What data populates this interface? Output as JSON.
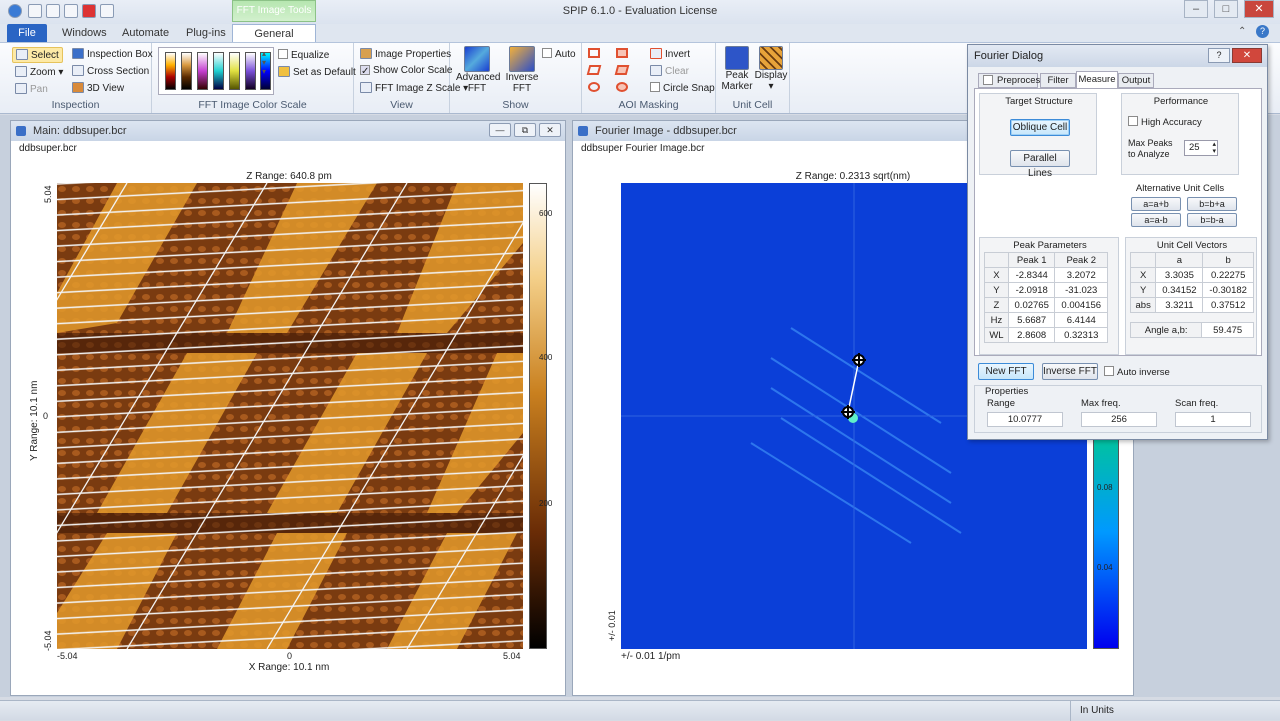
{
  "window": {
    "title": "SPIP 6.1.0 - Evaluation License",
    "context_tab": "FFT Image Tools"
  },
  "tabs": [
    "File",
    "Windows",
    "Automate",
    "Plug-ins",
    "General"
  ],
  "ribbon": {
    "inspection": {
      "select": "Select",
      "zoom": "Zoom",
      "pan": "Pan",
      "inspection_box": "Inspection Box",
      "cross_section": "Cross Section",
      "view_3d": "3D View",
      "label": "Inspection"
    },
    "color_scale": {
      "label": "FFT Image Color Scale",
      "equalize": "Equalize",
      "set_default": "Set as Default"
    },
    "view": {
      "image_properties": "Image Properties",
      "show_color_scale": "Show Color Scale",
      "fft_z_scale": "FFT Image Z Scale",
      "label": "View"
    },
    "show": {
      "advanced_fft": "Advanced\nFFT",
      "inverse_fft": "Inverse\nFFT",
      "auto": "Auto",
      "label": "Show"
    },
    "aoi": {
      "invert": "Invert",
      "clear": "Clear",
      "circle_snap": "Circle Snap",
      "label": "AOI Masking"
    },
    "unit_cell": {
      "peak_marker": "Peak\nMarker",
      "display": "Display",
      "label": "Unit Cell"
    }
  },
  "main_window": {
    "title": "Main: ddbsuper.bcr",
    "filename": "ddbsuper.bcr",
    "z_range": "Z Range:  640.8 pm",
    "y_ticks": [
      "5.04",
      "0",
      "-5.04"
    ],
    "x_ticks": [
      "-5.04",
      "0",
      "5.04"
    ],
    "y_label": "Y Range: 10.1 nm",
    "x_label": "X Range:  10.1 nm",
    "scale_ticks": [
      "600",
      "400",
      "200"
    ]
  },
  "fourier_window": {
    "title": "Fourier Image - ddbsuper.bcr",
    "filename": "ddbsuper Fourier Image.bcr",
    "z_range": "Z Range: 0.2313 sqrt(nm)",
    "y_label": "+/- 0.01",
    "x_label": "+/- 0.01 1/pm",
    "scale_ticks": [
      "0.08",
      "0.04"
    ]
  },
  "dialog": {
    "title": "Fourier Dialog",
    "tabs": [
      "Preprocess",
      "Filter",
      "Measure",
      "Output"
    ],
    "target_structure": "Target Structure",
    "oblique_cell": "Oblique Cell",
    "parallel_lines": "Parallel Lines",
    "performance": "Performance",
    "high_accuracy": "High Accuracy",
    "max_peaks": "Max Peaks\nto Analyze",
    "max_peaks_value": "25",
    "alt_unit_cells": "Alternative Unit Cells",
    "alt_buttons": [
      "a=a+b",
      "b=b+a",
      "a=a-b",
      "b=b-a"
    ],
    "peak_params": {
      "title": "Peak Parameters",
      "headers": [
        "Peak 1",
        "Peak 2"
      ],
      "rows": [
        [
          "X",
          "-2.8344",
          "3.2072"
        ],
        [
          "Y",
          "-2.0918",
          "-31.023"
        ],
        [
          "Z",
          "0.02765",
          "0.004156"
        ],
        [
          "Hz",
          "5.6687",
          "6.4144"
        ],
        [
          "WL",
          "2.8608",
          "0.32313"
        ]
      ]
    },
    "unit_vectors": {
      "title": "Unit Cell Vectors",
      "headers": [
        "a",
        "b"
      ],
      "rows": [
        [
          "X",
          "3.3035",
          "0.22275"
        ],
        [
          "Y",
          "0.34152",
          "-0.30182"
        ],
        [
          "abs",
          "3.3211",
          "0.37512"
        ]
      ],
      "angle_label": "Angle a,b:",
      "angle": "59.475"
    },
    "new_fft": "New FFT",
    "inverse_fft": "Inverse FFT",
    "auto_inverse": "Auto inverse",
    "properties": "Properties",
    "prop_headers": [
      "Range",
      "Max freq.",
      "Scan freq."
    ],
    "prop_values": [
      "10.0777",
      "256",
      "1"
    ]
  },
  "status": {
    "units": "In Units"
  }
}
